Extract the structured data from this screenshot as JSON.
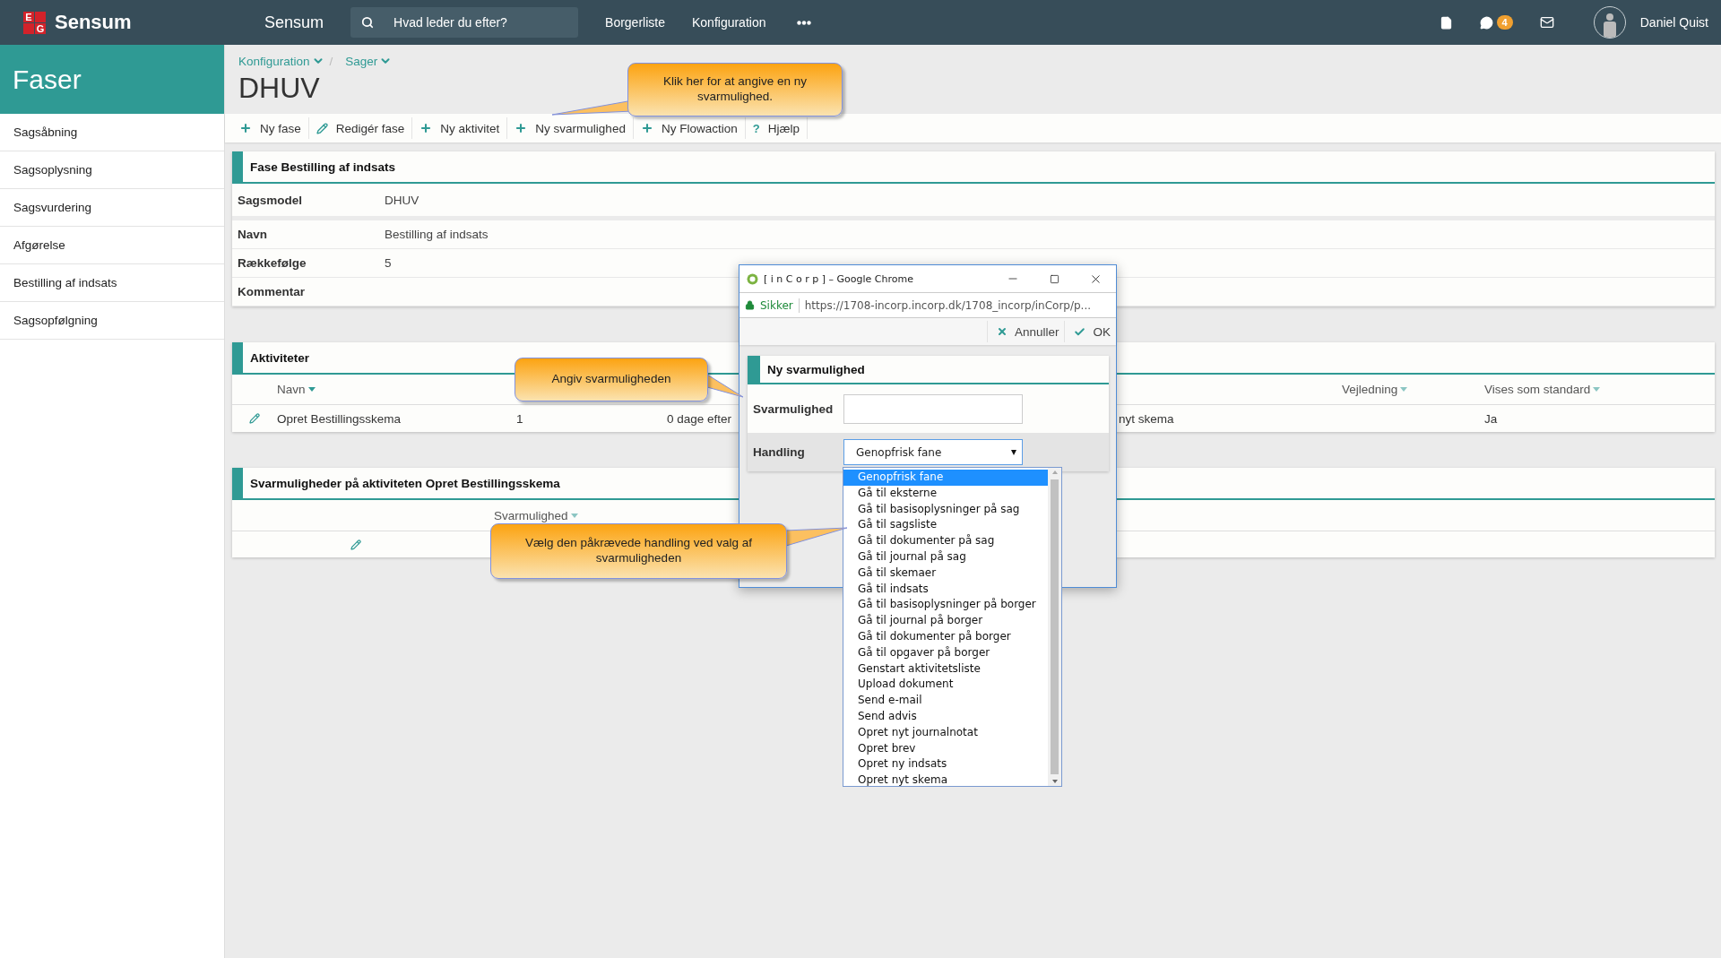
{
  "topbar": {
    "logo": {
      "letters": [
        "E",
        "G"
      ],
      "name": "Sensum"
    },
    "app_title": "Sensum",
    "search": {
      "placeholder": "Hvad leder du efter?"
    },
    "nav": [
      "Borgerliste",
      "Konfiguration"
    ],
    "notifications_badge": "4",
    "user": "Daniel Quist"
  },
  "sidebar": {
    "title": "Faser",
    "items": [
      {
        "label": "Sagsåbning"
      },
      {
        "label": "Sagsoplysning"
      },
      {
        "label": "Sagsvurdering"
      },
      {
        "label": "Afgørelse"
      },
      {
        "label": "Bestilling af indsats"
      },
      {
        "label": "Sagsopfølgning"
      }
    ]
  },
  "breadcrumb": {
    "items": [
      "Konfiguration",
      "Sager"
    ],
    "separator": "/"
  },
  "title": "DHUV",
  "toolbar": [
    {
      "label": "Ny fase",
      "kind": "add"
    },
    {
      "label": "Redigér fase",
      "kind": "edit"
    },
    {
      "label": "Ny aktivitet",
      "kind": "add"
    },
    {
      "label": "Ny svarmulighed",
      "kind": "add"
    },
    {
      "label": "Ny Flowaction",
      "kind": "add"
    },
    {
      "label": "Hjælp",
      "kind": "help",
      "symbol": "?"
    }
  ],
  "fase": {
    "title": "Fase Bestilling af indsats",
    "fields": [
      {
        "label": "Sagsmodel",
        "value": "DHUV"
      },
      {
        "label": "Navn",
        "value": "Bestilling af indsats"
      },
      {
        "label": "Rækkefølge",
        "value": "5"
      },
      {
        "label": "Kommentar"
      }
    ]
  },
  "aktiviteter": {
    "title": "Aktiviteter",
    "columns": {
      "navn": "Navn",
      "vejledning": "Vejledning",
      "vises_som_standard": "Vises som standard"
    },
    "rows": [
      {
        "navn": "Opret Bestillingsskema",
        "column_3": "1",
        "column_4": "0 dage efter",
        "column_6": "nyt skema",
        "vises_som_standard": "Ja"
      }
    ]
  },
  "svarmuligheder": {
    "title": "Svarmuligheder på aktiviteten Opret Bestillingsskema",
    "columns": [
      "Svarmulighed"
    ],
    "rows": [
      {
        "editable": true
      }
    ]
  },
  "popup": {
    "window_title": "[ i n C o r p ] – Google Chrome",
    "secure_label": "Sikker",
    "url": "https://1708-incorp.incorp.dk/1708_incorp/inCorp/p...",
    "actions": [
      {
        "label": "Annuller",
        "kind": "cancel"
      },
      {
        "label": "OK",
        "kind": "ok"
      }
    ],
    "panel_title": "Ny svarmulighed",
    "svarmulighed": {
      "label": "Svarmulighed"
    },
    "handling": {
      "label": "Handling",
      "value": "Genopfrisk fane",
      "options": [
        {
          "label": "Genopfrisk fane",
          "selected": true
        },
        {
          "label": "Gå til eksterne",
          "selected": false
        },
        {
          "label": "Gå til basisoplysninger på sag",
          "selected": false
        },
        {
          "label": "Gå til sagsliste",
          "selected": false
        },
        {
          "label": "Gå til dokumenter på sag",
          "selected": false
        },
        {
          "label": "Gå til journal på sag",
          "selected": false
        },
        {
          "label": "Gå til skemaer",
          "selected": false
        },
        {
          "label": "Gå til indsats",
          "selected": false
        },
        {
          "label": "Gå til basisoplysninger på borger",
          "selected": false
        },
        {
          "label": "Gå til journal på borger",
          "selected": false
        },
        {
          "label": "Gå til dokumenter på borger",
          "selected": false
        },
        {
          "label": "Gå til opgaver på borger",
          "selected": false
        },
        {
          "label": "Genstart aktivitetsliste",
          "selected": false
        },
        {
          "label": "Upload dokument",
          "selected": false
        },
        {
          "label": "Send e-mail",
          "selected": false
        },
        {
          "label": "Send advis",
          "selected": false
        },
        {
          "label": "Opret nyt journalnotat",
          "selected": false
        },
        {
          "label": "Opret brev",
          "selected": false
        },
        {
          "label": "Opret ny indsats",
          "selected": false
        },
        {
          "label": "Opret nyt skema",
          "selected": false
        }
      ]
    }
  },
  "callouts": [
    {
      "text": "Klik her for at angive en ny svarmulighed."
    },
    {
      "text": "Angiv svarmuligheden"
    },
    {
      "text": "Vælg den påkrævede handling ved valg af svarmuligheden"
    }
  ]
}
